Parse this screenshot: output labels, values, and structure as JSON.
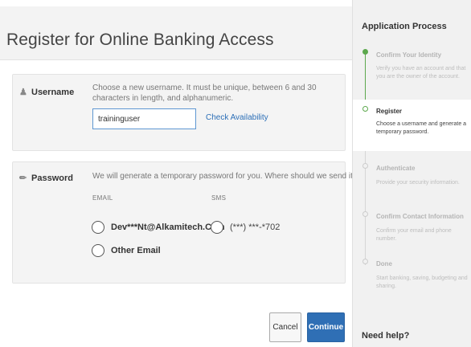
{
  "header": {
    "title": "Register for Online Banking Access"
  },
  "username": {
    "label": "Username",
    "icon": "person-icon",
    "description": "Choose a new username. It must be unique, between 6 and 30 characters in length, and alphanumeric.",
    "input_value": "traininguser",
    "check_link": "Check Availability"
  },
  "password": {
    "label": "Password",
    "icon": "key-icon",
    "description": "We will generate a temporary password for you. Where should we send it?",
    "email_header": "EMAIL",
    "sms_header": "SMS",
    "options": {
      "email": "Dev***Nt@Alkamitech.Com",
      "sms": "(***) ***-*702",
      "other": "Other Email"
    }
  },
  "buttons": {
    "cancel": "Cancel",
    "continue": "Continue"
  },
  "sidebar": {
    "title": "Application Process",
    "steps": [
      {
        "title": "Confirm Your Identity",
        "desc": "Verify you have an account and that you are the owner of the account.",
        "state": "completed"
      },
      {
        "title": "Register",
        "desc": "Choose a username and generate a temporary password.",
        "state": "active"
      },
      {
        "title": "Authenticate",
        "desc": "Provide your security information.",
        "state": "pending"
      },
      {
        "title": "Confirm Contact Information",
        "desc": "Confirm your email and phone number.",
        "state": "pending"
      },
      {
        "title": "Done",
        "desc": "Start banking, saving, budgeting and sharing.",
        "state": "pending"
      }
    ],
    "help": "Need help?"
  },
  "colors": {
    "accent": "#2f6fb5",
    "progress_green": "#5ca84d",
    "sidebar_bg": "#f1f1f1"
  }
}
